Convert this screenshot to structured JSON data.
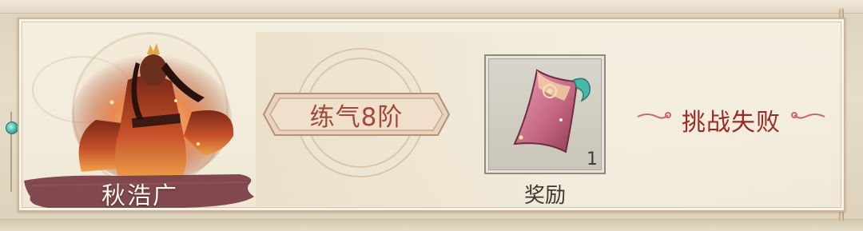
{
  "challenge": {
    "opponent_name": "秋浩广",
    "realm_level": "练气8阶",
    "reward": {
      "label": "奖励",
      "count": "1",
      "icon": "scroll-banner-icon"
    },
    "result": "挑战失败"
  },
  "colors": {
    "result_red": "#9a2a26",
    "level_text": "#a14a3c",
    "name_banner": "#7a4048"
  }
}
